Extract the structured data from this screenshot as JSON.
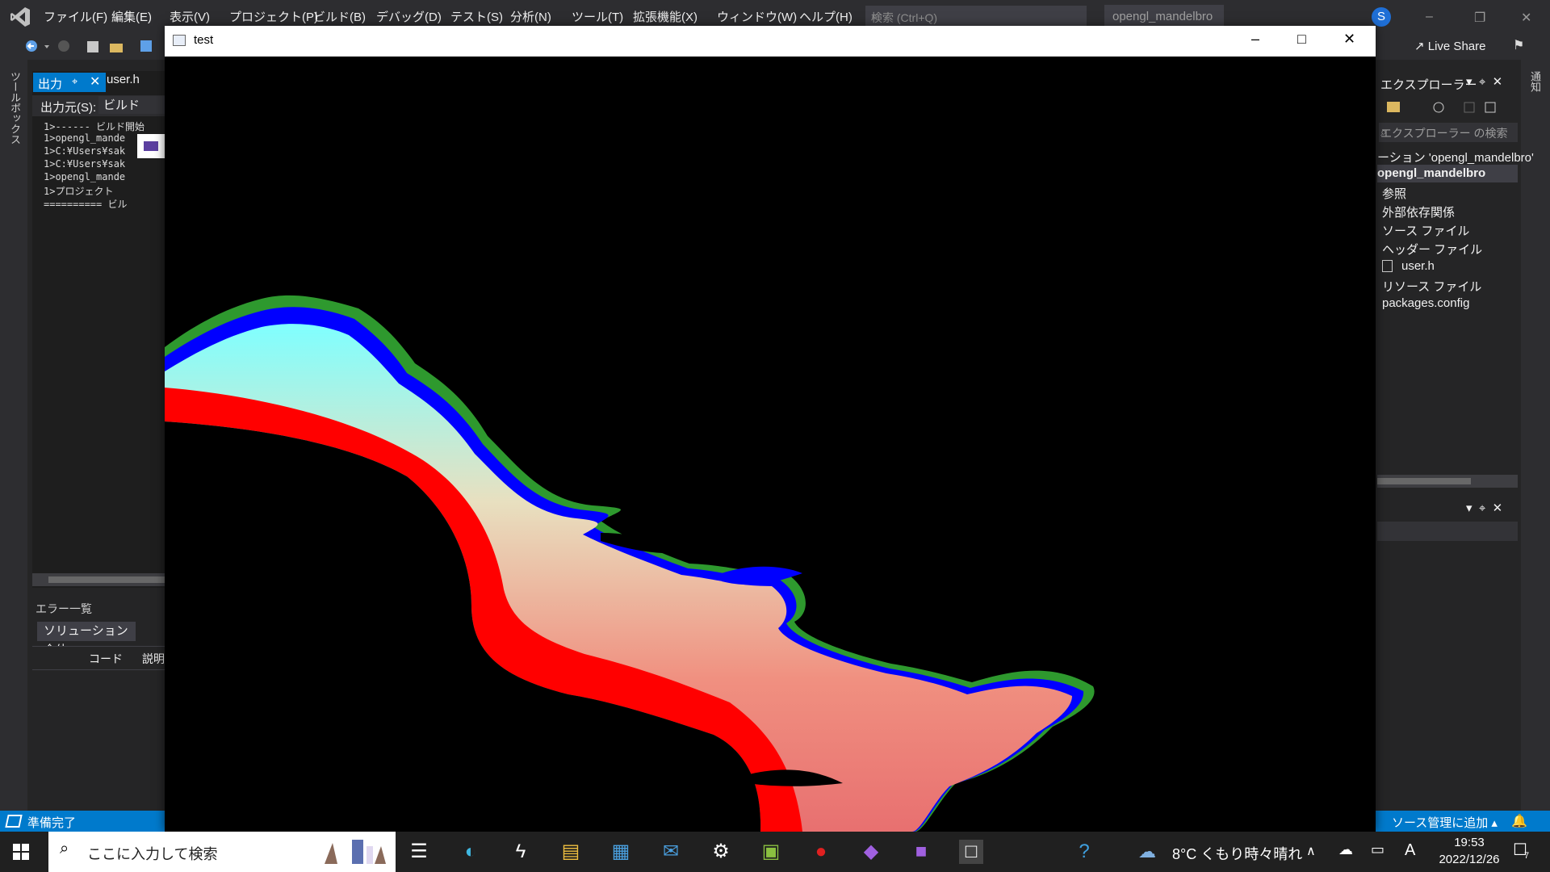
{
  "menubar": {
    "items": [
      "ファイル(F)",
      "編集(E)",
      "表示(V)",
      "プロジェクト(P)",
      "ビルド(B)",
      "デバッグ(D)",
      "テスト(S)",
      "分析(N)",
      "ツール(T)",
      "拡張機能(X)",
      "ウィンドウ(W)",
      "ヘルプ(H)"
    ],
    "search_placeholder": "検索 (Ctrl+Q)",
    "solution_title": "opengl_mandelbro",
    "avatar_initial": "S"
  },
  "toolbar": {
    "live_share": "Live Share"
  },
  "left_strip": {
    "toolbox": "ツールボックス"
  },
  "output": {
    "tab_label": "出力",
    "tab2_label": "user.h",
    "source_label": "出力元(S):",
    "source_value": "ビルド",
    "lines": [
      "1>------ ビルド開始",
      "1>opengl_mande",
      "1>C:¥Users¥sak",
      "1>C:¥Users¥sak",
      "1>opengl_mande",
      "1>プロジェクト",
      "========== ビル"
    ]
  },
  "errors": {
    "title": "エラー一覧",
    "scope": "ソリューション全体",
    "col_code": "コード",
    "col_desc": "説明"
  },
  "status": {
    "ready": "準備完了",
    "source_control": "ソース管理に追加"
  },
  "explorer": {
    "title": "エクスプローラー",
    "search_placeholder": "エクスプローラー の検索",
    "solution": "ーション 'opengl_mandelbro'",
    "project": "opengl_mandelbro",
    "items": [
      "参照",
      "外部依存関係",
      "ソース ファイル",
      "ヘッダー ファイル",
      "user.h",
      "リソース ファイル",
      "packages.config"
    ]
  },
  "right_strip": {
    "label": "通知"
  },
  "test_window": {
    "title": "test"
  },
  "taskbar": {
    "search_placeholder": "ここに入力して検索",
    "weather": "8°C  くもり時々晴れ",
    "time": "19:53",
    "date": "2022/12/26",
    "ime": "A",
    "notification_count": "7"
  },
  "colors": {
    "accent": "#007acc",
    "menubar": "#2d2d30",
    "panel": "#252526",
    "fractal_red": "#ff0000",
    "fractal_cyan": "#9fffe8",
    "fractal_blue": "#0000ff"
  }
}
